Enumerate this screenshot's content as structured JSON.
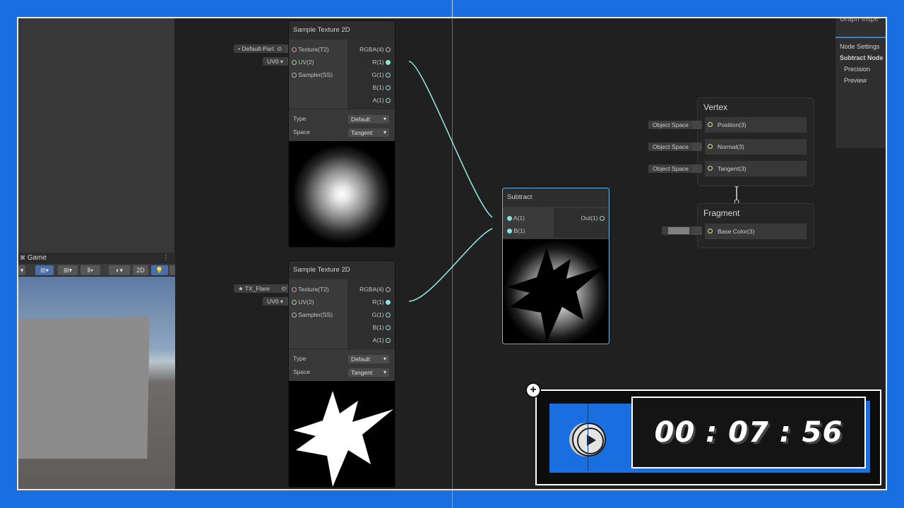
{
  "game_tab": {
    "title": "Game",
    "menu_glyph": "⋮"
  },
  "game_toolbar": {
    "mode_2d": "2D"
  },
  "node_top": {
    "title": "Sample Texture 2D",
    "inputs": [
      {
        "label": "Texture(T2)"
      },
      {
        "label": "UV(2)"
      },
      {
        "label": "Sampler(SS)"
      }
    ],
    "outputs": [
      "RGBA(4)",
      "R(1)",
      "G(1)",
      "B(1)",
      "A(1)"
    ],
    "type_label": "Type",
    "type_value": "Default",
    "space_label": "Space",
    "space_value": "Tangent",
    "texture_field": "Default-Part",
    "uv_field": "UV0"
  },
  "node_bottom": {
    "title": "Sample Texture 2D",
    "inputs": [
      {
        "label": "Texture(T2)"
      },
      {
        "label": "UV(2)"
      },
      {
        "label": "Sampler(SS)"
      }
    ],
    "outputs": [
      "RGBA(4)",
      "R(1)",
      "G(1)",
      "B(1)",
      "A(1)"
    ],
    "type_label": "Type",
    "type_value": "Default",
    "space_label": "Space",
    "space_value": "Tangent",
    "texture_field": "TX_Flare",
    "uv_field": "UV0"
  },
  "subtract_node": {
    "title": "Subtract",
    "input_a": "A(1)",
    "input_b": "B(1)",
    "output": "Out(1)"
  },
  "vertex_block": {
    "title": "Vertex",
    "rows": [
      {
        "label": "Position(3)",
        "source": "Object Space"
      },
      {
        "label": "Normal(3)",
        "source": "Object Space"
      },
      {
        "label": "Tangent(3)",
        "source": "Object Space"
      }
    ]
  },
  "fragment_block": {
    "title": "Fragment",
    "rows": [
      {
        "label": "Base Color(3)"
      }
    ]
  },
  "inspector": {
    "tab": "Graph Inspe",
    "node_settings": "Node Settings",
    "node_name": "Subtract Node",
    "precision": "Precision",
    "preview": "Preview"
  },
  "timer": {
    "time": "00 : 07 : 56",
    "plus": "+"
  },
  "colors": {
    "accent_blue": "#1a6fe0",
    "wire": "#8de1dc"
  }
}
